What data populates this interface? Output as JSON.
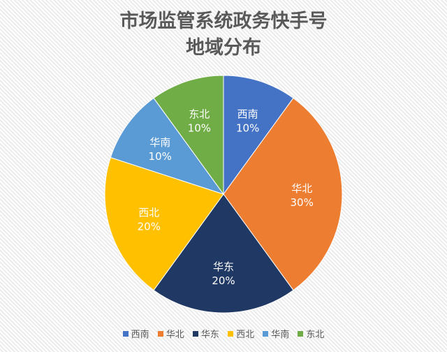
{
  "chart_data": {
    "type": "pie",
    "title": "市场监管系统政务快手号\n地域分布",
    "title_lines": [
      "市场监管系统政务快手号",
      "地域分布"
    ],
    "categories": [
      "西南",
      "华北",
      "华东",
      "西北",
      "华南",
      "东北"
    ],
    "values": [
      10,
      30,
      20,
      20,
      10,
      10
    ],
    "unit": "%",
    "labels": [
      "10%",
      "30%",
      "20%",
      "20%",
      "10%",
      "10%"
    ],
    "colors": [
      "#4472C4",
      "#ED7D31",
      "#203864",
      "#FFC000",
      "#5B9BD5",
      "#70AD47"
    ],
    "start_angle": "12 o'clock, clockwise",
    "legend_position": "bottom"
  }
}
